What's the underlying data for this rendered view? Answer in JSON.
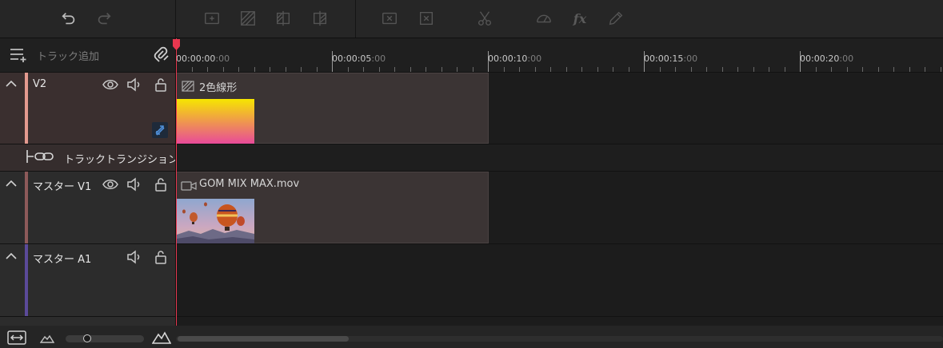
{
  "toolbar": {
    "icons": [
      "undo-icon",
      "redo-icon",
      "add-clip-icon",
      "pattern-icon",
      "split-left-icon",
      "split-right-icon",
      "delete-clip-icon",
      "delete-gap-icon",
      "scissors-icon",
      "speed-icon",
      "fx-icon",
      "pen-icon"
    ],
    "fx_label": "fx"
  },
  "header": {
    "add_track_label": "トラック追加"
  },
  "ruler": {
    "ticks": [
      {
        "main": "00:00:00",
        "frames": ":00"
      },
      {
        "main": "00:00:05",
        "frames": ":00"
      },
      {
        "main": "00:00:10",
        "frames": ":00"
      },
      {
        "main": "00:00:15",
        "frames": ":00"
      },
      {
        "main": "00:00:20",
        "frames": ":00"
      }
    ]
  },
  "tracks": {
    "v2": {
      "name": "V2",
      "color": "#e39a8f",
      "clip_title": "2色線形"
    },
    "transition": {
      "label": "トラックトランジション"
    },
    "v1": {
      "name": "マスター V1",
      "color": "#8d5a5a",
      "clip_title": "GOM MIX MAX.mov"
    },
    "a1": {
      "name": "マスター A1",
      "color": "#5b4a9a"
    }
  },
  "colors": {
    "playhead": "#e8374f",
    "clip_bg": "#3b3434"
  }
}
